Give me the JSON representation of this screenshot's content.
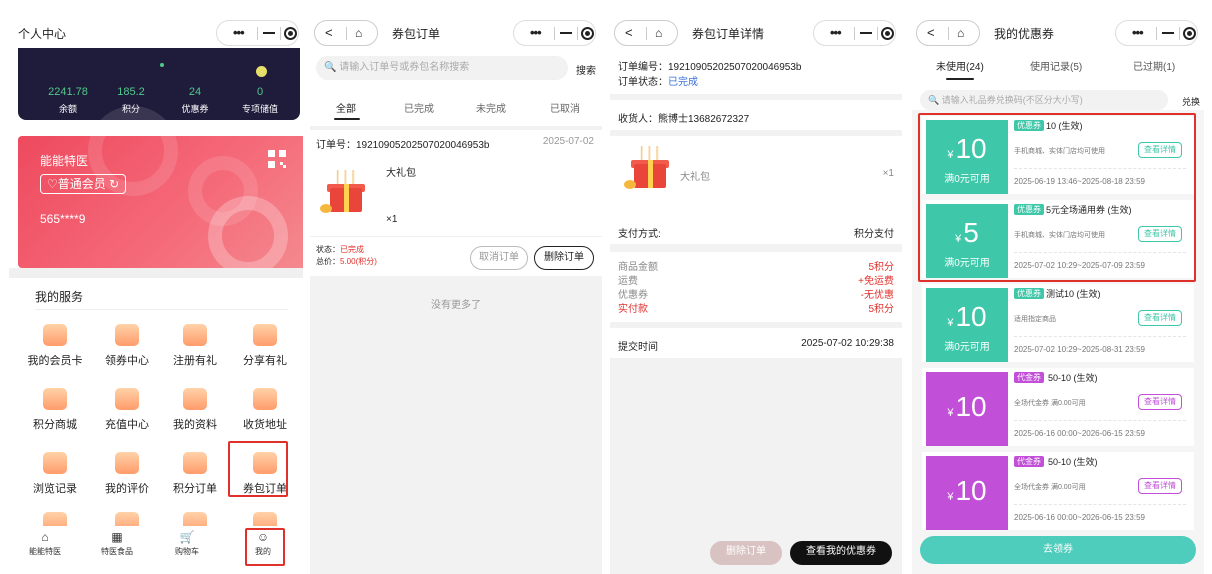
{
  "panel1": {
    "title": "个人中心",
    "stats": [
      {
        "value": "2241.78",
        "label": "余额"
      },
      {
        "value": "185.2",
        "label": "积分"
      },
      {
        "value": "24",
        "label": "优惠券"
      },
      {
        "value": "0",
        "label": "专项储值"
      }
    ],
    "card": {
      "name": "能能特医",
      "member": "♡普通会员 ↻",
      "phone": "565****9"
    },
    "services_title": "我的服务",
    "services": [
      "我的会员卡",
      "领券中心",
      "注册有礼",
      "分享有礼",
      "积分商城",
      "充值中心",
      "我的资料",
      "收货地址",
      "浏览记录",
      "我的评价",
      "积分订单",
      "券包订单"
    ],
    "tabs": [
      {
        "icon": "⌂",
        "label": "能能特医"
      },
      {
        "icon": "▦",
        "label": "特医食品"
      },
      {
        "icon": "🛒",
        "label": "购物车"
      },
      {
        "icon": "☺",
        "label": "我的"
      }
    ]
  },
  "panel2": {
    "title": "券包订单",
    "search_placeholder": "请输入订单号或券包名称搜索",
    "search_btn": "搜索",
    "tabs": [
      "全部",
      "已完成",
      "未完成",
      "已取消"
    ],
    "order": {
      "no": "订单号：19210905202507020046953b",
      "date": "2025-07-02",
      "product": "大礼包",
      "qty": "×1",
      "status_label": "状态：",
      "status": "已完成",
      "total_label": "总价：",
      "total": "5.00(积分)",
      "cancel": "取消订单",
      "delete": "删除订单"
    },
    "no_more": "没有更多了"
  },
  "panel3": {
    "title": "券包订单详情",
    "order_no": "订单编号：19210905202507020046953b",
    "status_label": "订单状态：",
    "status": "已完成",
    "receiver": "收货人：熊博士13682672327",
    "product": "大礼包",
    "qty": "×1",
    "pay_label": "支付方式:",
    "pay_value": "积分支付",
    "amounts": [
      {
        "k": "商品金额",
        "v": "5积分"
      },
      {
        "k": "运费",
        "v": "+免运费"
      },
      {
        "k": "优惠券",
        "v": "-无优惠"
      },
      {
        "k": "实付款",
        "v": "5积分"
      }
    ],
    "time_label": "提交时间",
    "time_value": "2025-07-02 10:29:38",
    "btn_delete": "删除订单",
    "btn_coupon": "查看我的优惠券"
  },
  "panel4": {
    "title": "我的优惠券",
    "tabs": [
      "未使用(24)",
      "使用记录(5)",
      "已过期(1)"
    ],
    "search_placeholder": "请输入礼品券兑换码(不区分大小写)",
    "search_btn": "兑换",
    "coupons": [
      {
        "badge": "优惠券",
        "name": "10 (生效)",
        "currency": "¥",
        "amount": "10",
        "cond": "满0元可用",
        "desc": "手机商城、实体门店均可使用",
        "view": "查看详情",
        "date": "2025-06-19 13:46~2025-08-18 23:59",
        "color": "#3ec7a8"
      },
      {
        "badge": "优惠券",
        "name": "5元全场通用券 (生效)",
        "currency": "¥",
        "amount": "5",
        "cond": "满0元可用",
        "desc": "手机商城、实体门店均可使用",
        "view": "查看详情",
        "date": "2025-07-02 10:29~2025-07-09 23:59",
        "color": "#3ec7a8"
      },
      {
        "badge": "优惠券",
        "name": "测试10 (生效)",
        "currency": "¥",
        "amount": "10",
        "cond": "满0元可用",
        "desc": "适用指定商品",
        "view": "查看详情",
        "date": "2025-07-02 10:29~2025-08-31 23:59",
        "color": "#3ec7a8"
      },
      {
        "badge": "代金券",
        "name": "50-10 (生效)",
        "currency": "¥",
        "amount": "10",
        "cond": "",
        "desc": "全场代金券 满0.00可用",
        "view": "查看详情",
        "date": "2025-06-16 00:00~2026-06-15 23:59",
        "color": "#c14fd8"
      },
      {
        "badge": "代金券",
        "name": "50-10 (生效)",
        "currency": "¥",
        "amount": "10",
        "cond": "",
        "desc": "全场代金券 满0.00可用",
        "view": "查看详情",
        "date": "2025-06-16 00:00~2026-06-15 23:59",
        "color": "#c14fd8"
      }
    ],
    "get_btn": "去领券"
  }
}
